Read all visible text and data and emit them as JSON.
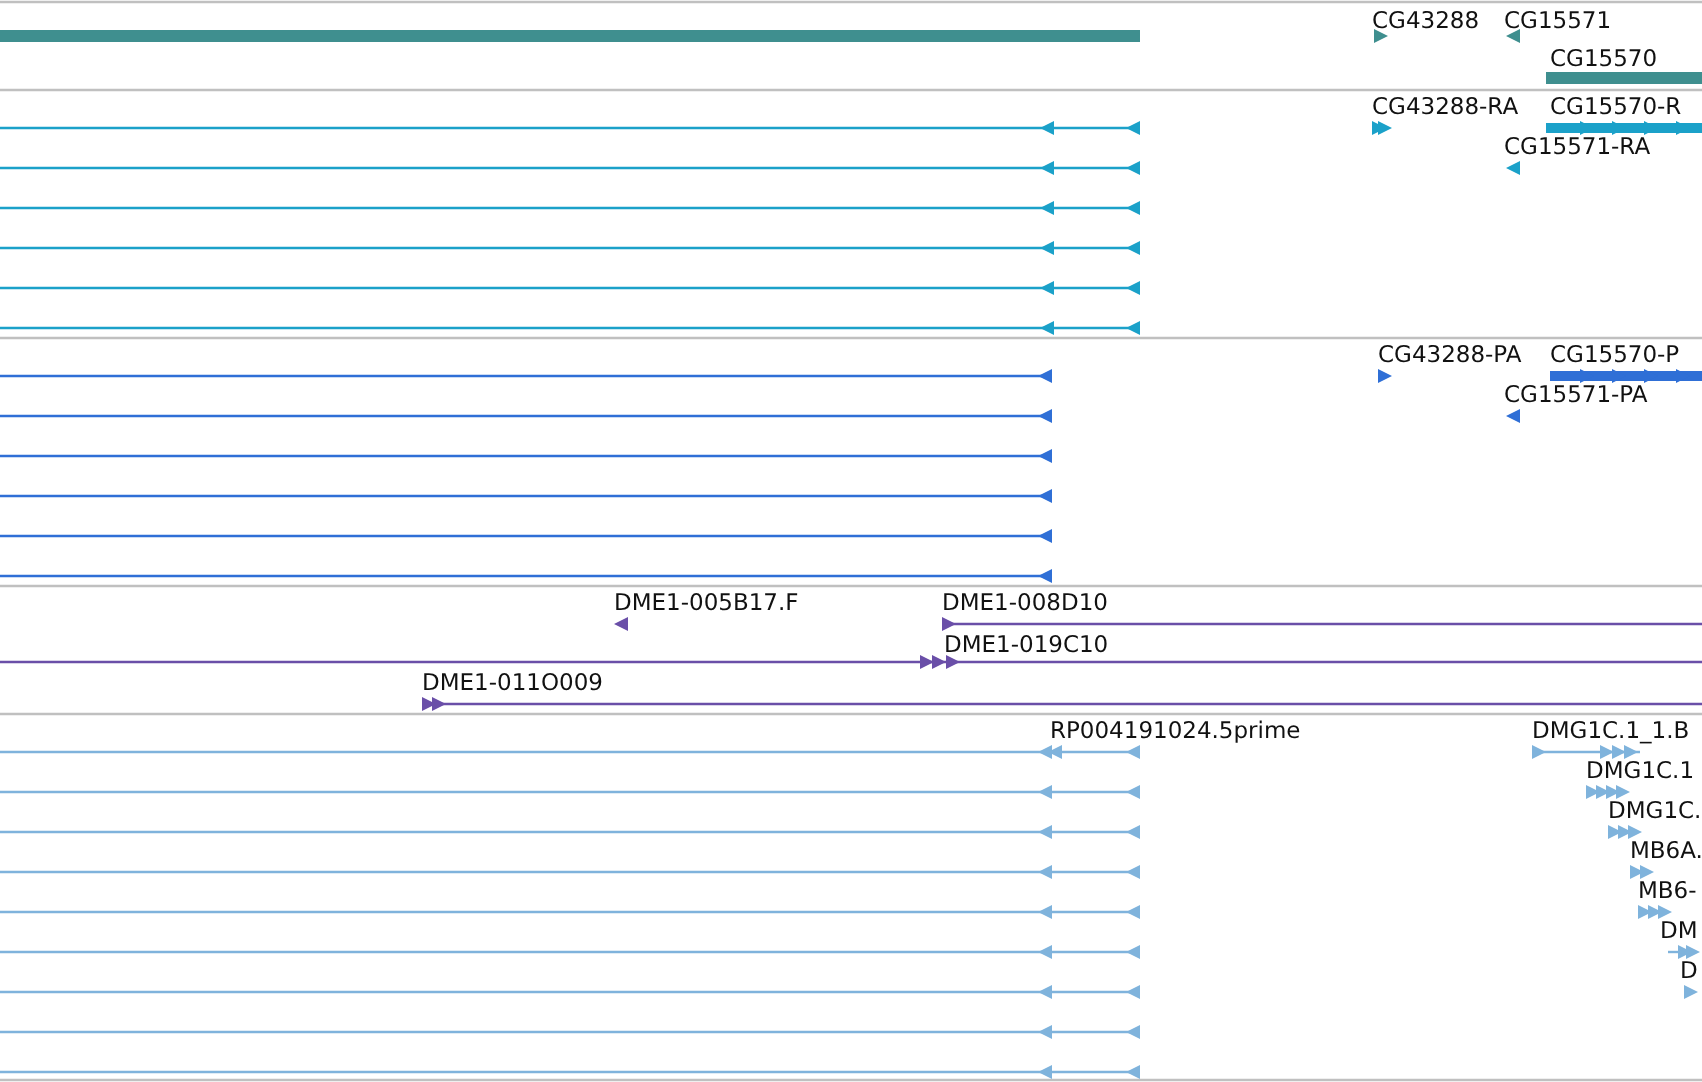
{
  "tracks": [
    {
      "color": "#3f8f8f",
      "features": [
        {
          "label": "CG43288"
        },
        {
          "label": "CG15571"
        },
        {
          "label": "CG15570"
        }
      ]
    },
    {
      "color": "#1ba1c9",
      "features": [
        {
          "label": "CG43288-RA"
        },
        {
          "label": "CG15570-R"
        },
        {
          "label": "CG15571-RA"
        }
      ]
    },
    {
      "color": "#2f6fd6",
      "features": [
        {
          "label": "CG43288-PA"
        },
        {
          "label": "CG15570-P"
        },
        {
          "label": "CG15571-PA"
        }
      ]
    },
    {
      "color": "#6a4fa8",
      "features": [
        {
          "label": "DME1-005B17.F"
        },
        {
          "label": "DME1-008D10"
        },
        {
          "label": "DME1-019C10"
        },
        {
          "label": "DME1-011O009"
        }
      ]
    },
    {
      "color": "#7fb3dc",
      "features": [
        {
          "label": "RP004191024.5prime"
        },
        {
          "label": "DMG1C.1_1.B"
        },
        {
          "label": "DMG1C.1"
        },
        {
          "label": "DMG1C."
        },
        {
          "label": "MB6A."
        },
        {
          "label": "MB6-"
        },
        {
          "label": "DM"
        },
        {
          "label": "D"
        }
      ]
    }
  ]
}
